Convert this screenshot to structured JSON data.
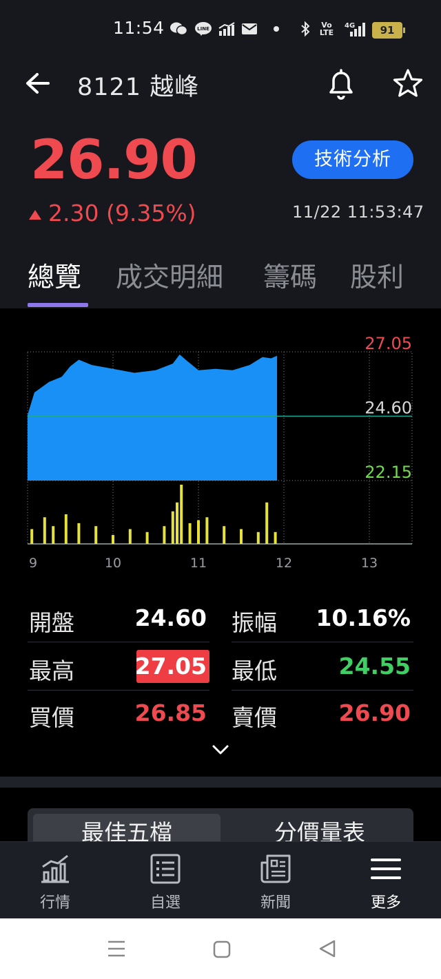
{
  "status_bar": {
    "time": "11:54",
    "battery": "91",
    "volte": "Vo LTE",
    "network": "4G"
  },
  "header": {
    "title": "8121 越峰"
  },
  "quote": {
    "price": "26.90",
    "change": "2.30 (9.35%)",
    "timestamp": "11/22 11:53:47",
    "tech_button": "技術分析",
    "up_color": "#ef4a4f"
  },
  "tabs": [
    {
      "label": "總覽"
    },
    {
      "label": "成交明細"
    },
    {
      "label": "籌碼"
    },
    {
      "label": "股利"
    }
  ],
  "chart_data": {
    "type": "area",
    "price_high_label": "27.05",
    "price_ref_label": "24.60",
    "price_low_label": "22.15",
    "ylim": [
      22.15,
      27.05
    ],
    "reference": 24.6,
    "x_ticks": [
      "9",
      "10",
      "11",
      "12",
      "13"
    ],
    "x_range": [
      9,
      13.5
    ],
    "price_series": {
      "x": [
        9.0,
        9.08,
        9.25,
        9.4,
        9.5,
        9.6,
        9.75,
        10.0,
        10.25,
        10.5,
        10.7,
        10.78,
        10.85,
        11.0,
        11.2,
        11.4,
        11.6,
        11.75,
        11.85,
        11.92
      ],
      "y": [
        24.65,
        25.5,
        25.9,
        26.1,
        26.5,
        26.75,
        26.55,
        26.4,
        26.25,
        26.35,
        26.6,
        26.95,
        26.75,
        26.35,
        26.4,
        26.35,
        26.55,
        26.85,
        26.8,
        26.9
      ]
    },
    "volume_series": {
      "x": [
        9.05,
        9.2,
        9.3,
        9.45,
        9.6,
        9.8,
        10.0,
        10.2,
        10.4,
        10.6,
        10.7,
        10.75,
        10.8,
        10.9,
        11.0,
        11.1,
        11.3,
        11.5,
        11.7,
        11.8,
        11.9
      ],
      "v": [
        0.25,
        0.45,
        0.3,
        0.5,
        0.35,
        0.3,
        0.15,
        0.25,
        0.2,
        0.3,
        0.55,
        0.7,
        1.0,
        0.35,
        0.4,
        0.45,
        0.3,
        0.25,
        0.2,
        0.7,
        0.2
      ]
    },
    "colors": {
      "area": "#1890f5",
      "volume": "#e6e23a",
      "high": "#ef4a4f",
      "ref": "#d8d8d8",
      "low": "#6fdc4c",
      "ref_line": "#1fa88f"
    }
  },
  "stats": {
    "open_label": "開盤",
    "open_value": "24.60",
    "amplitude_label": "振幅",
    "amplitude_value": "10.16%",
    "high_label": "最高",
    "high_value": "27.05",
    "low_label": "最低",
    "low_value": "24.55",
    "bid_label": "買價",
    "bid_value": "26.85",
    "ask_label": "賣價",
    "ask_value": "26.90",
    "colors": {
      "white": "#ffffff",
      "red": "#ef4a4f",
      "green": "#3fcf63"
    }
  },
  "segment": {
    "best_five": "最佳五檔",
    "price_volume": "分價量表"
  },
  "bottom_nav": [
    {
      "label": "行情",
      "icon": "chart-bars-icon"
    },
    {
      "label": "自選",
      "icon": "list-icon"
    },
    {
      "label": "新聞",
      "icon": "news-icon"
    },
    {
      "label": "更多",
      "icon": "menu-icon"
    }
  ]
}
